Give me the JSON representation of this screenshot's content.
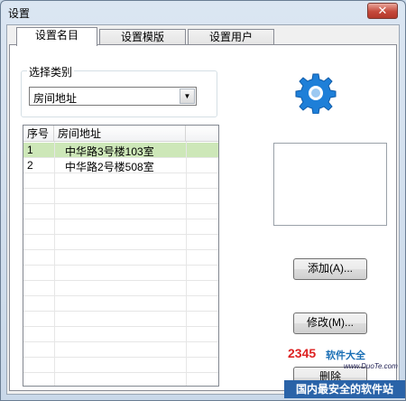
{
  "window": {
    "title": "设置",
    "close_label": "✕"
  },
  "tabs": [
    {
      "label": "设置名目",
      "active": true
    },
    {
      "label": "设置模版",
      "active": false
    },
    {
      "label": "设置用户",
      "active": false
    }
  ],
  "category": {
    "group_label": "选择类别",
    "selected": "房间地址"
  },
  "list": {
    "columns": [
      "序号",
      "房间地址"
    ],
    "rows": [
      {
        "index": "1",
        "address": "中华路3号楼103室",
        "selected": true
      },
      {
        "index": "2",
        "address": "中华路2号楼508室",
        "selected": false
      }
    ]
  },
  "buttons": {
    "add": "添加(A)...",
    "modify": "修改(M)...",
    "delete": "删除"
  },
  "watermark": {
    "logo": "2345",
    "site": "软件大全",
    "url": "www.DuoTe.com",
    "bar": "国内最安全的软件站"
  },
  "colors": {
    "selected_row": "#cde7b8",
    "gear": "#1e7fd8",
    "close_button": "#c5493b"
  }
}
